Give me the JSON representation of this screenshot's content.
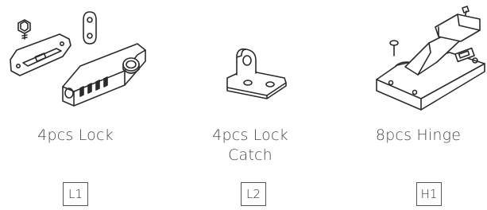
{
  "items": [
    {
      "caption": "4pcs Lock",
      "code": "L1",
      "image": "combination-lock-set"
    },
    {
      "caption_line1": "4pcs Lock",
      "caption_line2": "Catch",
      "code": "L2",
      "image": "lock-catch-bracket"
    },
    {
      "caption": "8pcs Hinge",
      "code": "H1",
      "image": "concealed-hinge"
    }
  ],
  "colors": {
    "line": "#2b2b2b",
    "text": "#4a4a4a",
    "box_border": "#555555"
  }
}
